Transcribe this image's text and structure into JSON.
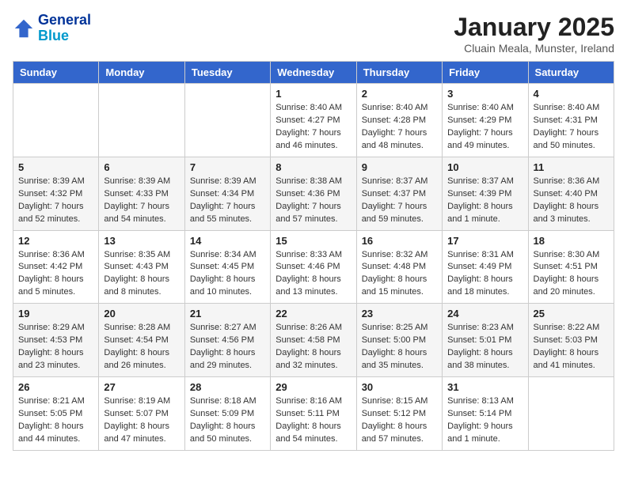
{
  "header": {
    "logo_line1": "General",
    "logo_line2": "Blue",
    "month_title": "January 2025",
    "subtitle": "Cluain Meala, Munster, Ireland"
  },
  "weekdays": [
    "Sunday",
    "Monday",
    "Tuesday",
    "Wednesday",
    "Thursday",
    "Friday",
    "Saturday"
  ],
  "weeks": [
    [
      {
        "num": "",
        "info": ""
      },
      {
        "num": "",
        "info": ""
      },
      {
        "num": "",
        "info": ""
      },
      {
        "num": "1",
        "info": "Sunrise: 8:40 AM\nSunset: 4:27 PM\nDaylight: 7 hours\nand 46 minutes."
      },
      {
        "num": "2",
        "info": "Sunrise: 8:40 AM\nSunset: 4:28 PM\nDaylight: 7 hours\nand 48 minutes."
      },
      {
        "num": "3",
        "info": "Sunrise: 8:40 AM\nSunset: 4:29 PM\nDaylight: 7 hours\nand 49 minutes."
      },
      {
        "num": "4",
        "info": "Sunrise: 8:40 AM\nSunset: 4:31 PM\nDaylight: 7 hours\nand 50 minutes."
      }
    ],
    [
      {
        "num": "5",
        "info": "Sunrise: 8:39 AM\nSunset: 4:32 PM\nDaylight: 7 hours\nand 52 minutes."
      },
      {
        "num": "6",
        "info": "Sunrise: 8:39 AM\nSunset: 4:33 PM\nDaylight: 7 hours\nand 54 minutes."
      },
      {
        "num": "7",
        "info": "Sunrise: 8:39 AM\nSunset: 4:34 PM\nDaylight: 7 hours\nand 55 minutes."
      },
      {
        "num": "8",
        "info": "Sunrise: 8:38 AM\nSunset: 4:36 PM\nDaylight: 7 hours\nand 57 minutes."
      },
      {
        "num": "9",
        "info": "Sunrise: 8:37 AM\nSunset: 4:37 PM\nDaylight: 7 hours\nand 59 minutes."
      },
      {
        "num": "10",
        "info": "Sunrise: 8:37 AM\nSunset: 4:39 PM\nDaylight: 8 hours\nand 1 minute."
      },
      {
        "num": "11",
        "info": "Sunrise: 8:36 AM\nSunset: 4:40 PM\nDaylight: 8 hours\nand 3 minutes."
      }
    ],
    [
      {
        "num": "12",
        "info": "Sunrise: 8:36 AM\nSunset: 4:42 PM\nDaylight: 8 hours\nand 5 minutes."
      },
      {
        "num": "13",
        "info": "Sunrise: 8:35 AM\nSunset: 4:43 PM\nDaylight: 8 hours\nand 8 minutes."
      },
      {
        "num": "14",
        "info": "Sunrise: 8:34 AM\nSunset: 4:45 PM\nDaylight: 8 hours\nand 10 minutes."
      },
      {
        "num": "15",
        "info": "Sunrise: 8:33 AM\nSunset: 4:46 PM\nDaylight: 8 hours\nand 13 minutes."
      },
      {
        "num": "16",
        "info": "Sunrise: 8:32 AM\nSunset: 4:48 PM\nDaylight: 8 hours\nand 15 minutes."
      },
      {
        "num": "17",
        "info": "Sunrise: 8:31 AM\nSunset: 4:49 PM\nDaylight: 8 hours\nand 18 minutes."
      },
      {
        "num": "18",
        "info": "Sunrise: 8:30 AM\nSunset: 4:51 PM\nDaylight: 8 hours\nand 20 minutes."
      }
    ],
    [
      {
        "num": "19",
        "info": "Sunrise: 8:29 AM\nSunset: 4:53 PM\nDaylight: 8 hours\nand 23 minutes."
      },
      {
        "num": "20",
        "info": "Sunrise: 8:28 AM\nSunset: 4:54 PM\nDaylight: 8 hours\nand 26 minutes."
      },
      {
        "num": "21",
        "info": "Sunrise: 8:27 AM\nSunset: 4:56 PM\nDaylight: 8 hours\nand 29 minutes."
      },
      {
        "num": "22",
        "info": "Sunrise: 8:26 AM\nSunset: 4:58 PM\nDaylight: 8 hours\nand 32 minutes."
      },
      {
        "num": "23",
        "info": "Sunrise: 8:25 AM\nSunset: 5:00 PM\nDaylight: 8 hours\nand 35 minutes."
      },
      {
        "num": "24",
        "info": "Sunrise: 8:23 AM\nSunset: 5:01 PM\nDaylight: 8 hours\nand 38 minutes."
      },
      {
        "num": "25",
        "info": "Sunrise: 8:22 AM\nSunset: 5:03 PM\nDaylight: 8 hours\nand 41 minutes."
      }
    ],
    [
      {
        "num": "26",
        "info": "Sunrise: 8:21 AM\nSunset: 5:05 PM\nDaylight: 8 hours\nand 44 minutes."
      },
      {
        "num": "27",
        "info": "Sunrise: 8:19 AM\nSunset: 5:07 PM\nDaylight: 8 hours\nand 47 minutes."
      },
      {
        "num": "28",
        "info": "Sunrise: 8:18 AM\nSunset: 5:09 PM\nDaylight: 8 hours\nand 50 minutes."
      },
      {
        "num": "29",
        "info": "Sunrise: 8:16 AM\nSunset: 5:11 PM\nDaylight: 8 hours\nand 54 minutes."
      },
      {
        "num": "30",
        "info": "Sunrise: 8:15 AM\nSunset: 5:12 PM\nDaylight: 8 hours\nand 57 minutes."
      },
      {
        "num": "31",
        "info": "Sunrise: 8:13 AM\nSunset: 5:14 PM\nDaylight: 9 hours\nand 1 minute."
      },
      {
        "num": "",
        "info": ""
      }
    ]
  ]
}
